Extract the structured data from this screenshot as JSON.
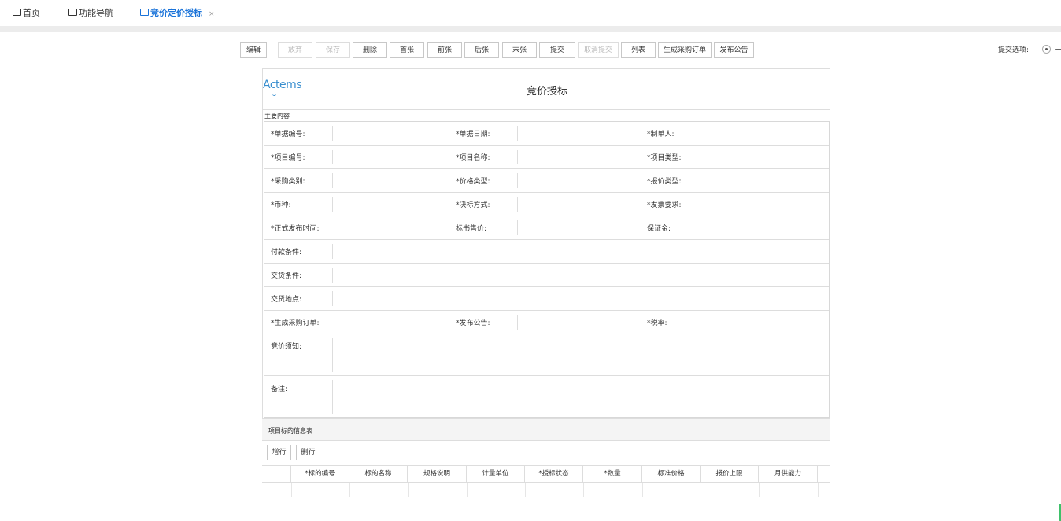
{
  "tabs": [
    {
      "label": "首页",
      "active": false
    },
    {
      "label": "功能导航",
      "active": false
    },
    {
      "label": "竞价定价授标",
      "active": true
    }
  ],
  "tab_close_icon": "×",
  "toolbar": {
    "buttons": [
      {
        "label": "编辑",
        "disabled": false
      },
      {
        "label": "放弃",
        "disabled": true
      },
      {
        "label": "保存",
        "disabled": true
      },
      {
        "label": "删除",
        "disabled": false
      },
      {
        "label": "首张",
        "disabled": false
      },
      {
        "label": "前张",
        "disabled": false
      },
      {
        "label": "后张",
        "disabled": false
      },
      {
        "label": "末张",
        "disabled": false
      },
      {
        "label": "提交",
        "disabled": false
      },
      {
        "label": "取消提交",
        "disabled": true
      },
      {
        "label": "列表",
        "disabled": false
      },
      {
        "label": "生成采购订单",
        "disabled": false
      },
      {
        "label": "发布公告",
        "disabled": false
      }
    ]
  },
  "submit_option": {
    "label": "提交选项:",
    "value": "一般"
  },
  "form": {
    "logo_text": "Actems",
    "title": "竞价授标",
    "section_label": "主要内容",
    "rows": [
      [
        "*单据编号:",
        "*单据日期:",
        "*制单人:"
      ],
      [
        "*项目编号:",
        "*项目名称:",
        "*项目类型:"
      ],
      [
        "*采购类别:",
        "*价格类型:",
        "*报价类型:"
      ],
      [
        "*币种:",
        "*决标方式:",
        "*发票要求:"
      ],
      [
        "*正式发布时间:",
        "标书售价:",
        "保证金:"
      ],
      [
        "付款条件:"
      ],
      [
        "交货条件:"
      ],
      [
        "交货地点:"
      ],
      [
        "*生成采购订单:",
        "*发布公告:",
        "*税率:"
      ],
      [
        "竞价须知:"
      ],
      [
        "备注:"
      ]
    ]
  },
  "info_table": {
    "title": "项目标的信息表",
    "add_row_label": "增行",
    "delete_row_label": "删行",
    "columns": [
      "",
      "*标的编号",
      "标的名称",
      "规格说明",
      "计量单位",
      "*授标状态",
      "*数量",
      "标准价格",
      "报价上限",
      "月供能力"
    ]
  }
}
